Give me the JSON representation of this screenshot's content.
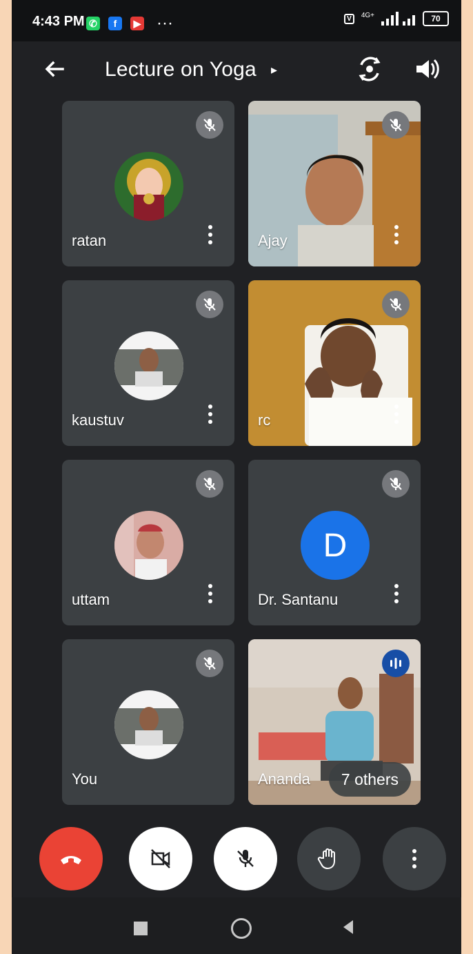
{
  "status": {
    "time": "4:43 PM",
    "more_dots": "···",
    "network_label": "4G+",
    "battery": "70"
  },
  "header": {
    "title": "Lecture on Yoga",
    "title_arrow": "▸"
  },
  "participants": [
    {
      "name": "ratan",
      "state": "muted"
    },
    {
      "name": "Ajay",
      "state": "muted"
    },
    {
      "name": "kaustuv",
      "state": "muted"
    },
    {
      "name": "rc",
      "state": "muted"
    },
    {
      "name": "uttam",
      "state": "muted"
    },
    {
      "name": "Dr. Santanu",
      "state": "muted",
      "initial": "D"
    },
    {
      "name": "You",
      "state": "muted"
    },
    {
      "name": "Ananda",
      "state": "speaking"
    }
  ],
  "overflow": {
    "label": "7 others"
  },
  "colors": {
    "background": "#202124",
    "tile": "#3c4043",
    "end_call": "#ea4335",
    "avatar_blue": "#1a73e8"
  },
  "icons": {
    "back": "arrow-left",
    "camera_switch": "camera-switch",
    "speaker": "speaker",
    "mute": "mic-off",
    "hand": "hand",
    "more": "more-vertical"
  }
}
